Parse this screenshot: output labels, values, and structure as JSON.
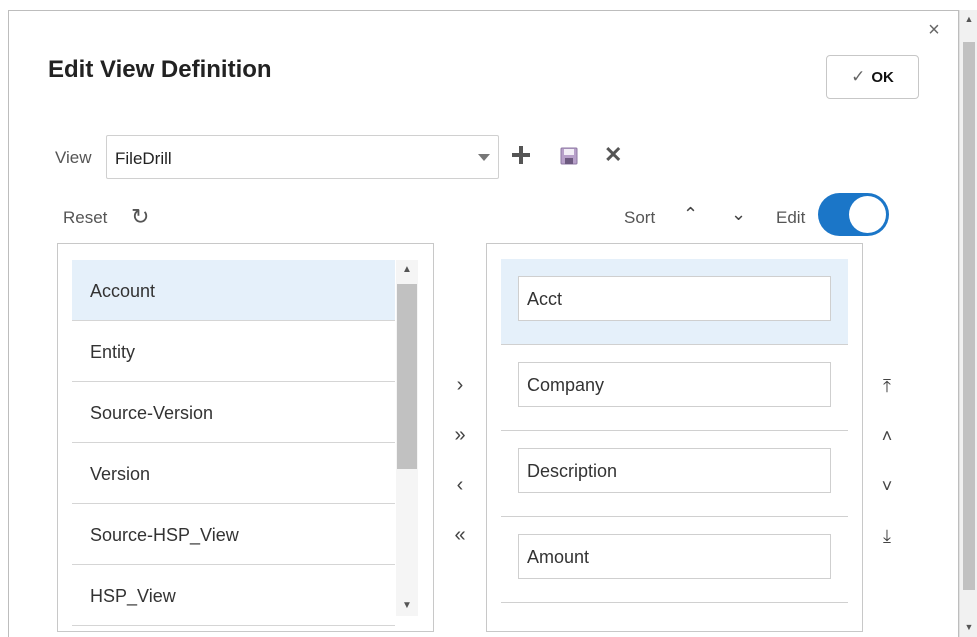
{
  "dialog": {
    "title": "Edit View Definition",
    "close_glyph": "×",
    "ok_label": "OK",
    "ok_check_glyph": "✓"
  },
  "view": {
    "label": "View",
    "selected": "FileDrill"
  },
  "toolbar": {
    "reset_label": "Reset",
    "reset_glyph": "↻",
    "sort_label": "Sort",
    "sort_up_glyph": "⌃",
    "sort_down_glyph": "⌄",
    "edit_label": "Edit",
    "edit_enabled": true,
    "delete_glyph": "✕"
  },
  "available_columns": [
    {
      "label": "Account",
      "selected": true
    },
    {
      "label": "Entity"
    },
    {
      "label": "Source-Version"
    },
    {
      "label": "Version"
    },
    {
      "label": "Source-HSP_View"
    },
    {
      "label": "HSP_View"
    }
  ],
  "selected_columns": [
    {
      "label": "Acct",
      "selected": true
    },
    {
      "label": "Company"
    },
    {
      "label": "Description"
    },
    {
      "label": "Amount"
    }
  ],
  "move_buttons": {
    "move_right": "›",
    "move_all_right": "»",
    "move_left": "‹",
    "move_all_left": "«"
  },
  "order_buttons": {
    "move_top": "⤒",
    "move_up": "˄",
    "move_down": "˅",
    "move_bottom": "⤓"
  },
  "colors": {
    "accent": "#1b76c8",
    "selected_row": "#e5f0fa"
  },
  "icons": {
    "add": "plus-icon",
    "save": "save-icon",
    "delete": "delete-icon",
    "reset": "reset-icon",
    "close": "close-icon",
    "check": "check-icon"
  }
}
